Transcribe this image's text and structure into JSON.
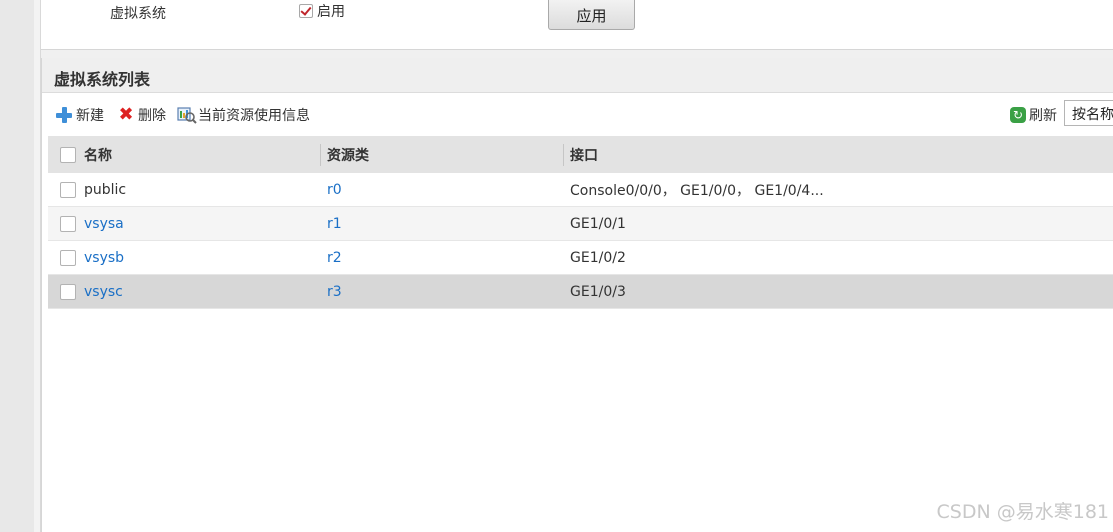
{
  "settings": {
    "label": "虚拟系统",
    "enable_label": "启用",
    "enable_checked": true,
    "apply_label": "应用"
  },
  "panel": {
    "title": "虚拟系统列表"
  },
  "toolbar": {
    "new_label": "新建",
    "delete_label": "删除",
    "resource_info_label": "当前资源使用信息",
    "refresh_label": "刷新",
    "sort_label": "按名称"
  },
  "table": {
    "headers": {
      "name": "名称",
      "resource_class": "资源类",
      "interface": "接口"
    },
    "rows": [
      {
        "name": "public",
        "resource_class": "r0",
        "interface": "Console0/0/0， GE1/0/0， GE1/0/4..."
      },
      {
        "name": "vsysa",
        "resource_class": "r1",
        "interface": "GE1/0/1"
      },
      {
        "name": "vsysb",
        "resource_class": "r2",
        "interface": "GE1/0/2"
      },
      {
        "name": "vsysc",
        "resource_class": "r3",
        "interface": "GE1/0/3"
      }
    ]
  },
  "watermark": "CSDN @易水寒181",
  "colors": {
    "link": "#1a6fc6",
    "header_bg": "#e3e3e3",
    "selected_row": "#d7d7d7",
    "check_mark": "#c0262c"
  }
}
